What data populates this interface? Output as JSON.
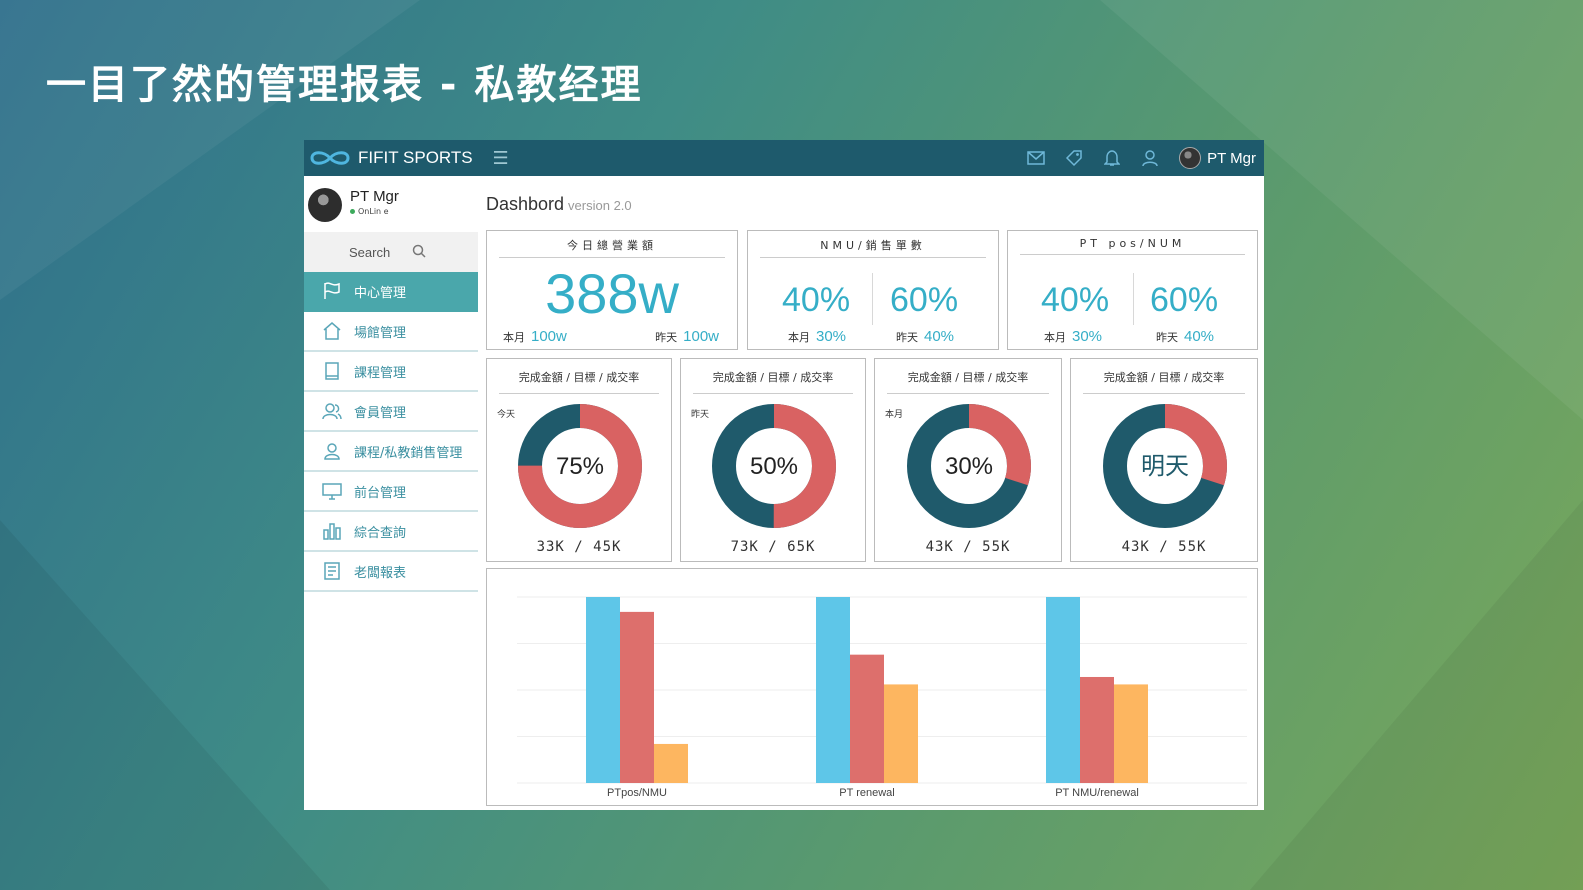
{
  "slide": {
    "title": "一目了然的管理报表 - 私教经理"
  },
  "topbar": {
    "brand": "FIFIT SPORTS",
    "icons": [
      "mail-icon",
      "tag-icon",
      "bell-icon",
      "user-icon"
    ],
    "user_name": "PT Mgr",
    "color": "#1e5a6c"
  },
  "sidebar": {
    "profile": {
      "name": "PT Mgr",
      "status": "OnLin e"
    },
    "search_label": "Search",
    "items": [
      {
        "label": "中心管理",
        "icon": "flag-icon",
        "active": true
      },
      {
        "label": "場館管理",
        "icon": "home-icon",
        "active": false
      },
      {
        "label": "課程管理",
        "icon": "book-icon",
        "active": false
      },
      {
        "label": "會員管理",
        "icon": "users-icon",
        "active": false
      },
      {
        "label": "課程/私教銷售管理",
        "icon": "person-icon",
        "active": false
      },
      {
        "label": "前台管理",
        "icon": "monitor-icon",
        "active": false
      },
      {
        "label": "綜合查詢",
        "icon": "bar-chart-icon",
        "active": false
      },
      {
        "label": "老闆報表",
        "icon": "report-icon",
        "active": false
      }
    ]
  },
  "dashboard": {
    "title": "Dashbord",
    "version": "version 2.0",
    "kpis": [
      {
        "title": "今日總營業額",
        "value": "388w",
        "left_label": "本月",
        "left_value": "100w",
        "right_label": "昨天",
        "right_value": "100w"
      },
      {
        "title": "NMU/銷售單數",
        "value_a": "40%",
        "value_b": "60%",
        "left_label": "本月",
        "left_value": "30%",
        "right_label": "昨天",
        "right_value": "40%"
      },
      {
        "title": "PT pos/NUM",
        "value_a": "40%",
        "value_b": "60%",
        "left_label": "本月",
        "left_value": "30%",
        "right_label": "昨天",
        "right_value": "40%"
      }
    ],
    "donuts": [
      {
        "title": "完成金額 / 目標 / 成交率",
        "tag": "今天",
        "center": "75%",
        "fraction": 0.75,
        "footer": "33K / 45K"
      },
      {
        "title": "完成金額 / 目標 / 成交率",
        "tag": "昨天",
        "center": "50%",
        "fraction": 0.5,
        "footer": "73K / 65K"
      },
      {
        "title": "完成金額 / 目標 / 成交率",
        "tag": "本月",
        "center": "30%",
        "fraction": 0.3,
        "footer": "43K / 55K"
      },
      {
        "title": "完成金額 / 目標 / 成交率",
        "tag": "",
        "center": "明天",
        "fraction": 0.3,
        "footer": "43K / 55K"
      }
    ],
    "donut_colors": {
      "filled": "#d96262",
      "rest": "#1f5a6b"
    }
  },
  "chart_data": {
    "type": "bar",
    "categories": [
      "PTpos/NMU",
      "PT renewal",
      "PT NMU/renewal"
    ],
    "series": [
      {
        "values": [
          100,
          100,
          100
        ],
        "color": "#5ec6e8"
      },
      {
        "values": [
          92,
          69,
          57
        ],
        "color": "#dd6f6c"
      },
      {
        "values": [
          21,
          53,
          53
        ],
        "color": "#fdb660"
      }
    ],
    "ylim": [
      0,
      100
    ],
    "grid": true
  }
}
